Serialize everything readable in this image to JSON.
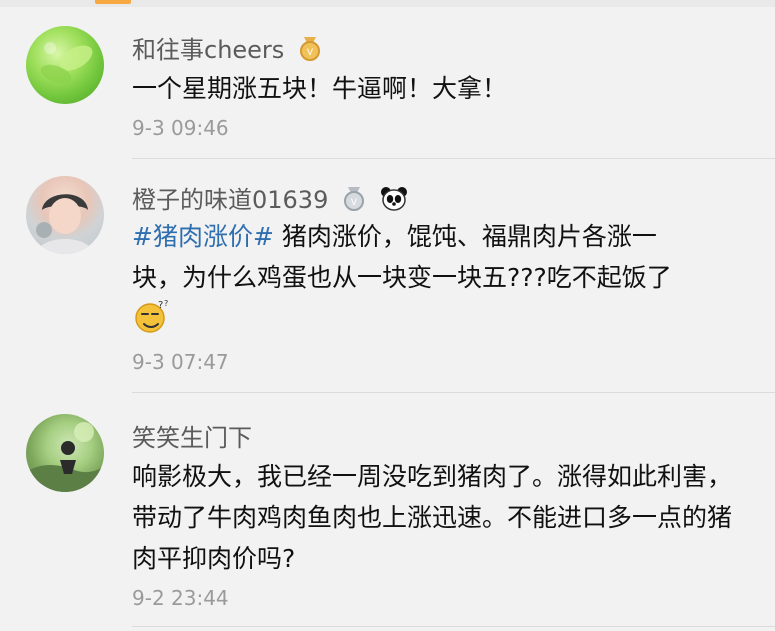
{
  "comments": [
    {
      "username": "和往事cheers",
      "text": "一个星期涨五块！牛逼啊！大拿！",
      "time": "9-3 09:46"
    },
    {
      "username": "橙子的味道01639",
      "hashtag": "#猪肉涨价#",
      "text_line1": " 猪肉涨价，馄饨、福鼎肉片各涨一",
      "text_line2": "块，为什么鸡蛋也从一块变一块五???吃不起饭了",
      "time": "9-3 07:47"
    },
    {
      "username": "笑笑生门下",
      "text": "响影极大，我已经一周没吃到猪肉了。涨得如此利害，带动了牛肉鸡肉鱼肉也上涨迅速。不能进口多一点的猪肉平抑肉价吗?",
      "time": "9-2 23:44"
    }
  ],
  "colors": {
    "background": "#f2f2f2",
    "username": "#5b5b5b",
    "hashtag": "#2f6fb0",
    "time": "#9a9a9a"
  },
  "icons": {
    "badge1": "gold-medal-icon",
    "badge2": "silver-medal-icon",
    "badge3": "panda-icon",
    "emoji": "sleepy-face-emoji"
  }
}
